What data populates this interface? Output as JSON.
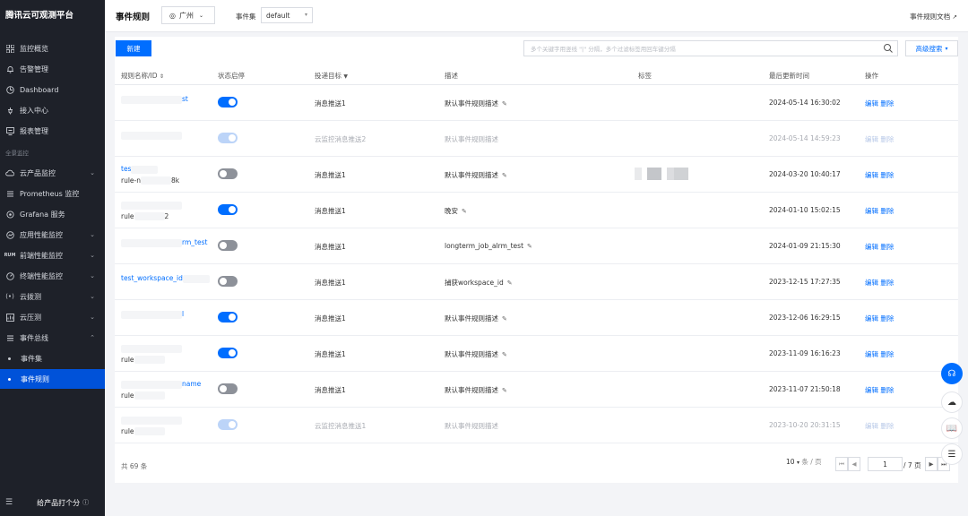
{
  "brand": "腾讯云可观测平台",
  "nav": {
    "overview": "监控概览",
    "alarm": "告警管理",
    "dashboard": "Dashboard",
    "integration": "接入中心",
    "report": "报表管理",
    "group_title": "全景监控",
    "cloud_product": "云产品监控",
    "prometheus": "Prometheus 监控",
    "grafana": "Grafana 服务",
    "apm": "应用性能监控",
    "rum": "前端性能监控",
    "terminal": "终端性能监控",
    "dial": "云拨测",
    "pressure": "云压测",
    "eventbus": "事件总线",
    "event_set": "事件集",
    "event_rule": "事件规则",
    "feedback": "给产品打个分"
  },
  "header": {
    "title": "事件规则",
    "region": "广州",
    "event_set_label": "事件集",
    "event_set_value": "default",
    "doc_link": "事件规则文档"
  },
  "toolbar": {
    "new_label": "新建",
    "search_placeholder": "多个关键字用竖线 \"|\" 分隔，多个过滤标签用回车键分隔",
    "advanced_label": "高级搜索"
  },
  "table": {
    "columns": [
      "规则名称/ID",
      "状态启停",
      "投递目标",
      "描述",
      "标签",
      "最后更新时间",
      "操作"
    ],
    "edit_label": "编辑",
    "delete_label": "删除",
    "rows": [
      {
        "name": "",
        "name_suffix": "st",
        "id": "",
        "toggle": "on",
        "target": "消息推送1",
        "desc": "默认事件规则描述",
        "edit_icon": true,
        "updated": "2024-05-14 16:30:02",
        "dim": false
      },
      {
        "name": "",
        "name_suffix": "",
        "id": "",
        "toggle": "ondis",
        "target": "云监控消息推送2",
        "desc": "默认事件规则描述",
        "edit_icon": false,
        "updated": "2024-05-14 14:59:23",
        "dim": true
      },
      {
        "name": "tes",
        "name_suffix": "",
        "id": "rule-n",
        "id_suffix": "8k",
        "toggle": "off",
        "target": "消息推送1",
        "desc": "默认事件规则描述",
        "edit_icon": true,
        "updated": "2024-03-20 10:40:17",
        "dim": false,
        "tags": true
      },
      {
        "name": "",
        "name_suffix": "",
        "id": "rule",
        "id_suffix": "2",
        "toggle": "on",
        "target": "消息推送1",
        "desc": "晚安",
        "edit_icon": true,
        "updated": "2024-01-10 15:02:15",
        "dim": false
      },
      {
        "name": "",
        "name_suffix": "rm_test",
        "id": "",
        "toggle": "off",
        "target": "消息推送1",
        "desc": "longterm_job_alrm_test",
        "edit_icon": true,
        "updated": "2024-01-09 21:15:30",
        "dim": false
      },
      {
        "name": "test_workspace_id",
        "name_suffix": "",
        "id": "",
        "toggle": "off",
        "target": "消息推送1",
        "desc": "捕获workspace_id",
        "edit_icon": true,
        "updated": "2023-12-15 17:27:35",
        "dim": false
      },
      {
        "name": "",
        "name_suffix": "l",
        "id": "",
        "toggle": "on",
        "target": "消息推送1",
        "desc": "默认事件规则描述",
        "edit_icon": true,
        "updated": "2023-12-06 16:29:15",
        "dim": false
      },
      {
        "name": "",
        "name_suffix": "",
        "id": "rule",
        "id_suffix": "",
        "toggle": "on",
        "target": "消息推送1",
        "desc": "默认事件规则描述",
        "edit_icon": true,
        "updated": "2023-11-09 16:16:23",
        "dim": false
      },
      {
        "name": "",
        "name_suffix": "name",
        "id": "rule",
        "id_suffix": "",
        "toggle": "off",
        "target": "消息推送1",
        "desc": "默认事件规则描述",
        "edit_icon": true,
        "updated": "2023-11-07 21:50:18",
        "dim": false
      },
      {
        "name": "",
        "name_suffix": "",
        "id": "rule",
        "id_suffix": "",
        "toggle": "ondis",
        "target": "云监控消息推送1",
        "desc": "默认事件规则描述",
        "edit_icon": false,
        "updated": "2023-10-20 20:31:15",
        "dim": true
      }
    ]
  },
  "footer": {
    "total": "共 69 条",
    "page_size": "10",
    "page_size_unit": "条 / 页",
    "current_page": "1",
    "total_pages": "/ 7 页"
  },
  "colors": {
    "accent": "#006eff",
    "sidebar": "#1e2129",
    "active": "#0052d9"
  }
}
